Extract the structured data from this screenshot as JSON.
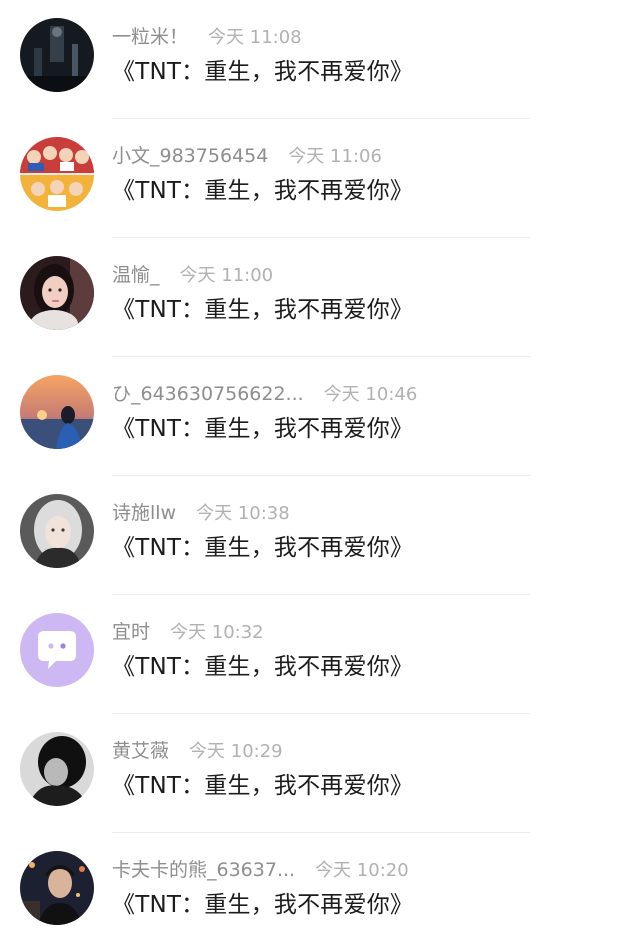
{
  "comments": [
    {
      "username": "一粒米！",
      "time": "今天 11:08",
      "message": "《TNT：重生，我不再爱你》",
      "avatar_desc": "dark-blurry-photo",
      "avatar_colors": [
        "#101418",
        "#3b4552"
      ]
    },
    {
      "username": "小文_983756454",
      "time": "今天 11:06",
      "message": "《TNT：重生，我不再爱你》",
      "avatar_desc": "group-photo-collage",
      "avatar_colors": [
        "#d8413c",
        "#f0b53c"
      ]
    },
    {
      "username": "温愉_",
      "time": "今天 11:00",
      "message": "《TNT：重生，我不再爱你》",
      "avatar_desc": "girl-portrait",
      "avatar_colors": [
        "#2a1a1a",
        "#e8c6b8"
      ]
    },
    {
      "username": "ひ_643630756622...",
      "time": "今天 10:46",
      "message": "《TNT：重生，我不再爱你》",
      "avatar_desc": "sunset-sea-silhouette",
      "avatar_colors": [
        "#f0945b",
        "#3d4f78"
      ]
    },
    {
      "username": "诗施llw",
      "time": "今天 10:38",
      "message": "《TNT：重生，我不再爱你》",
      "avatar_desc": "silver-hair-girl",
      "avatar_colors": [
        "#d6d6d6",
        "#4d4d4d"
      ]
    },
    {
      "username": "宜时",
      "time": "今天 10:32",
      "message": "《TNT：重生，我不再爱你》",
      "avatar_desc": "default-chat-bubble-avatar",
      "avatar_colors": [
        "#cbb7f2",
        "#ffffff"
      ]
    },
    {
      "username": "黄艾薇",
      "time": "今天 10:29",
      "message": "《TNT：重生，我不再爱你》",
      "avatar_desc": "dark-portrait",
      "avatar_colors": [
        "#141414",
        "#8a8a8a"
      ]
    },
    {
      "username": "卡夫卡的熊_63637...",
      "time": "今天 10:20",
      "message": "《TNT：重生，我不再爱你》",
      "avatar_desc": "boy-night-street",
      "avatar_colors": [
        "#1b1e2a",
        "#c47a4a"
      ]
    }
  ]
}
